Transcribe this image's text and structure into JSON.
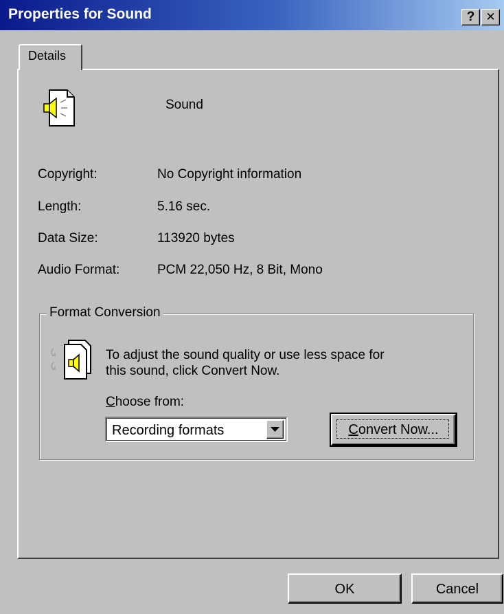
{
  "window": {
    "title": "Properties for Sound",
    "help_button": "?",
    "close_button": "✕"
  },
  "tabs": [
    {
      "label": "Details",
      "active": true
    }
  ],
  "file": {
    "icon": "sound-file-icon",
    "name": "Sound"
  },
  "properties": [
    {
      "label": "Copyright:",
      "value": "No Copyright information"
    },
    {
      "label": "Length:",
      "value": "5.16 sec."
    },
    {
      "label": "Data Size:",
      "value": "113920 bytes"
    },
    {
      "label": "Audio Format:",
      "value": "PCM 22,050 Hz, 8 Bit, Mono"
    }
  ],
  "format_conversion": {
    "title": "Format Conversion",
    "icon": "sound-convert-icon",
    "description_line1": "To adjust the sound quality or use less space for",
    "description_line2": "this sound, click Convert Now.",
    "choose_label_accel": "C",
    "choose_label_rest": "hoose from:",
    "select_value": "Recording formats",
    "convert_accel": "C",
    "convert_rest": "onvert Now..."
  },
  "buttons": {
    "ok": "OK",
    "cancel": "Cancel"
  },
  "colors": {
    "title_bar_start": "#0a1a8c",
    "title_bar_end": "#a6caf0",
    "face": "#c0c0c0"
  }
}
